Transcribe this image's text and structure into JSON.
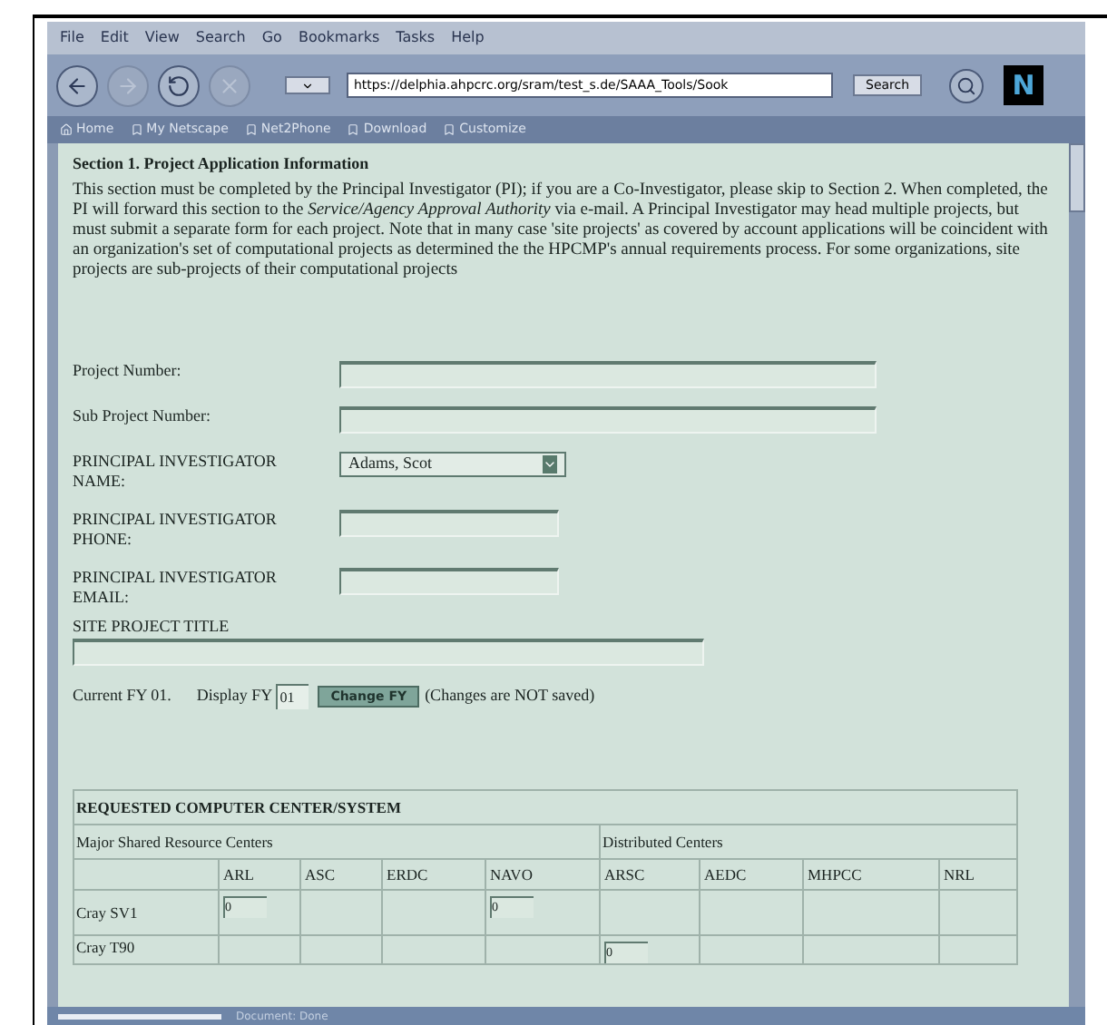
{
  "menu_bar": [
    "File",
    "Edit",
    "View",
    "Search",
    "Go",
    "Bookmarks",
    "Tasks",
    "Help"
  ],
  "nav_buttons": [
    {
      "kind": "back",
      "disabled": false
    },
    {
      "kind": "forward",
      "disabled": true
    },
    {
      "kind": "reload",
      "disabled": false
    },
    {
      "kind": "stop",
      "disabled": true
    }
  ],
  "address": {
    "value": "https://delphia.ahpcrc.org/sram/test_s.de/SAAA_Tools/Sook"
  },
  "search_button": "Search",
  "logo_letter": "N",
  "bookmarks": [
    "Home",
    "My Netscape",
    "Net2Phone",
    "Download",
    "Customize"
  ],
  "section": {
    "title": "Section 1. Project Application Information",
    "intro": "This section must be completed by the Principal Investigator (PI); if you are a Co-Investigator, please skip to Section 2. When completed, the PI will forward this section to the *Service/Agency Approval Authority* via e-mail. A Principal Investigator may head multiple projects, but must submit a separate form for each project. Note that in many case 'site projects' as covered by account applications will be coincident with an organization's set of computational projects as determined the the HPCMP's annual requirements process. For some organizations, site projects are sub-projects of their computational projects"
  },
  "fields": [
    {
      "kind": "text",
      "label": "Project Number:"
    },
    {
      "kind": "text",
      "label": "Sub Project Number:"
    },
    {
      "kind": "select",
      "label": "PRINCIPAL INVESTIGATOR NAME:",
      "value": "Adams, Scot"
    },
    {
      "kind": "short_text",
      "label": "PRINCIPAL INVESTIGATOR PHONE:"
    },
    {
      "kind": "short_text",
      "label": "PRINCIPAL INVESTIGATOR EMAIL:"
    }
  ],
  "site_project_title": {
    "label": "SITE PROJECT TITLE"
  },
  "fiscal_year": {
    "current": "Current FY 01.",
    "display_label": "Display FY",
    "display_value": "01",
    "button": "Change FY",
    "note": "(Changes are NOT saved)"
  },
  "table": {
    "title": "REQUESTED COMPUTER CENTER/SYSTEM",
    "groups": [
      "Major Shared Resource Centers",
      "Distributed Centers"
    ],
    "columns": [
      "ARL",
      "ASC",
      "ERDC",
      "NAVO",
      "ARSC",
      "AEDC",
      "MHPCC",
      "NRL"
    ],
    "rows": [
      {
        "label": "Cray SV1",
        "cells": [
          "0",
          null,
          null,
          "0",
          null,
          null,
          null,
          null
        ]
      },
      {
        "label": "Cray T90",
        "cells": [
          null,
          null,
          null,
          null,
          "0",
          null,
          null,
          null
        ]
      }
    ]
  },
  "status_bar": "Document: Done"
}
